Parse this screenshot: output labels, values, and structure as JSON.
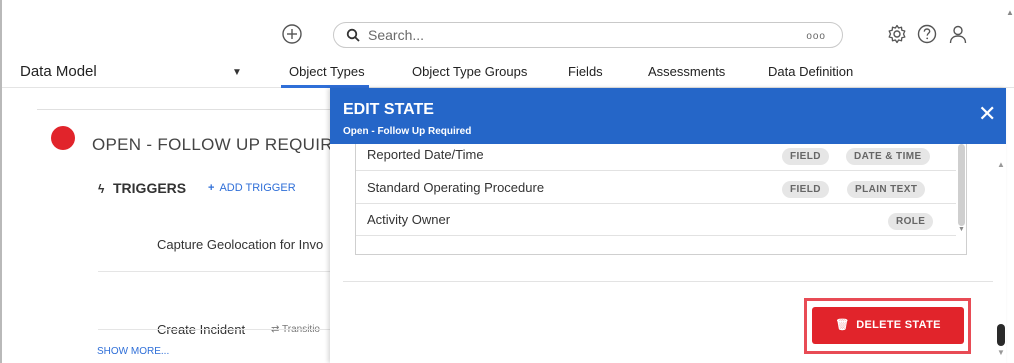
{
  "topbar": {
    "search_placeholder": "Search...",
    "search_more": "ooo"
  },
  "nav": {
    "module_select": "Data Model",
    "tabs": [
      "Object Types",
      "Object Type Groups",
      "Fields",
      "Assessments",
      "Data Definition"
    ],
    "active_tab": "Object Types"
  },
  "state": {
    "title": "OPEN - FOLLOW UP REQUIRE",
    "color": "#e1242b",
    "triggers_label": "TRIGGERS",
    "add_trigger_label": "ADD TRIGGER",
    "triggers": [
      {
        "name": "Capture Geolocation for Invo"
      },
      {
        "name": "Create Incident",
        "type": "Transitio"
      }
    ],
    "show_more": "SHOW MORE..."
  },
  "modal": {
    "title": "EDIT STATE",
    "subtitle": "Open - Follow Up Required",
    "header_color": "#2566c8",
    "rows": [
      {
        "name": "Reported Date/Time",
        "badges": [
          "FIELD",
          "DATE & TIME"
        ]
      },
      {
        "name": "Standard Operating Procedure",
        "badges": [
          "FIELD",
          "PLAIN TEXT"
        ]
      },
      {
        "name": "Activity Owner",
        "badges": [
          "ROLE"
        ]
      }
    ],
    "delete_label": "DELETE STATE",
    "delete_color": "#e1242b"
  }
}
